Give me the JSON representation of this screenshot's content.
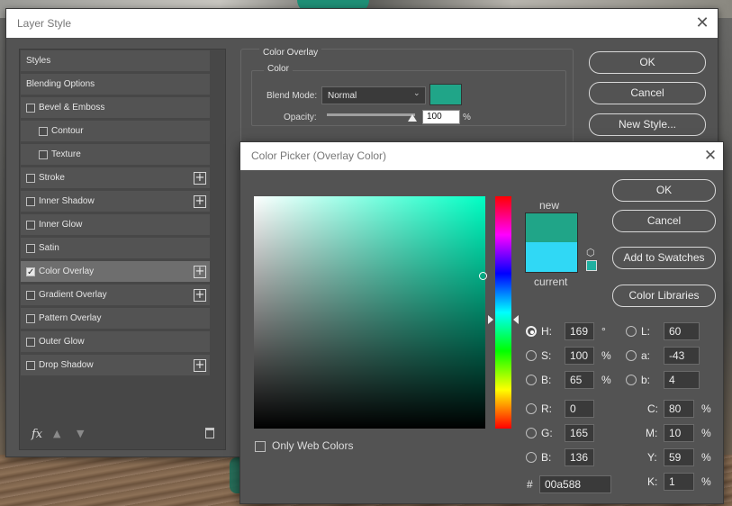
{
  "layer_style": {
    "title": "Layer Style",
    "styles_list": [
      {
        "label": "Styles",
        "checkbox": false,
        "checked": false,
        "plus": false,
        "indent": 0,
        "selected": false
      },
      {
        "label": "Blending Options",
        "checkbox": false,
        "checked": false,
        "plus": false,
        "indent": 0,
        "selected": false
      },
      {
        "label": "Bevel & Emboss",
        "checkbox": true,
        "checked": false,
        "plus": false,
        "indent": 0,
        "selected": false
      },
      {
        "label": "Contour",
        "checkbox": true,
        "checked": false,
        "plus": false,
        "indent": 1,
        "selected": false
      },
      {
        "label": "Texture",
        "checkbox": true,
        "checked": false,
        "plus": false,
        "indent": 1,
        "selected": false
      },
      {
        "label": "Stroke",
        "checkbox": true,
        "checked": false,
        "plus": true,
        "indent": 0,
        "selected": false
      },
      {
        "label": "Inner Shadow",
        "checkbox": true,
        "checked": false,
        "plus": true,
        "indent": 0,
        "selected": false
      },
      {
        "label": "Inner Glow",
        "checkbox": true,
        "checked": false,
        "plus": false,
        "indent": 0,
        "selected": false
      },
      {
        "label": "Satin",
        "checkbox": true,
        "checked": false,
        "plus": false,
        "indent": 0,
        "selected": false
      },
      {
        "label": "Color Overlay",
        "checkbox": true,
        "checked": true,
        "plus": true,
        "indent": 0,
        "selected": true
      },
      {
        "label": "Gradient Overlay",
        "checkbox": true,
        "checked": false,
        "plus": true,
        "indent": 0,
        "selected": false
      },
      {
        "label": "Pattern Overlay",
        "checkbox": true,
        "checked": false,
        "plus": false,
        "indent": 0,
        "selected": false
      },
      {
        "label": "Outer Glow",
        "checkbox": true,
        "checked": false,
        "plus": false,
        "indent": 0,
        "selected": false
      },
      {
        "label": "Drop Shadow",
        "checkbox": true,
        "checked": false,
        "plus": true,
        "indent": 0,
        "selected": false
      }
    ],
    "bottom_icons": [
      "fx-icon",
      "arrow-up-icon",
      "arrow-down-icon",
      "trash-icon"
    ],
    "color_overlay": {
      "group_title": "Color Overlay",
      "color_group_title": "Color",
      "blend_mode_label": "Blend Mode:",
      "blend_mode_value": "Normal",
      "overlay_color": "#20a588",
      "opacity_label": "Opacity:",
      "opacity_value": "100",
      "opacity_unit": "%",
      "opacity_level": 1.0
    },
    "buttons": {
      "ok": "OK",
      "cancel": "Cancel",
      "new_style": "New Style..."
    }
  },
  "color_picker": {
    "title": "Color Picker (Overlay Color)",
    "new_label": "new",
    "current_label": "current",
    "new_color": "#20a588",
    "current_color": "#30d8f5",
    "web_safe_color": "#20b0a0",
    "hue_base_color": "#00ffc4",
    "buttons": {
      "ok": "OK",
      "cancel": "Cancel",
      "add_to_swatches": "Add to Swatches",
      "color_libraries": "Color Libraries"
    },
    "only_web_colors": "Only Web Colors",
    "hsb": {
      "h_label": "H:",
      "h_value": "169",
      "h_unit": "°",
      "s_label": "S:",
      "s_value": "100",
      "s_unit": "%",
      "b_label": "B:",
      "b_value": "65",
      "b_unit": "%"
    },
    "rgb": {
      "r_label": "R:",
      "r_value": "0",
      "g_label": "G:",
      "g_value": "165",
      "b_label": "B:",
      "b_value": "136"
    },
    "lab": {
      "l_label": "L:",
      "l_value": "60",
      "a_label": "a:",
      "a_value": "-43",
      "b_label": "b:",
      "b_value": "4"
    },
    "cmyk": {
      "c_label": "C:",
      "c_value": "80",
      "c_unit": "%",
      "m_label": "M:",
      "m_value": "10",
      "m_unit": "%",
      "y_label": "Y:",
      "y_value": "59",
      "y_unit": "%",
      "k_label": "K:",
      "k_value": "1",
      "k_unit": "%"
    },
    "hex_label": "#",
    "hex_value": "00a588"
  }
}
